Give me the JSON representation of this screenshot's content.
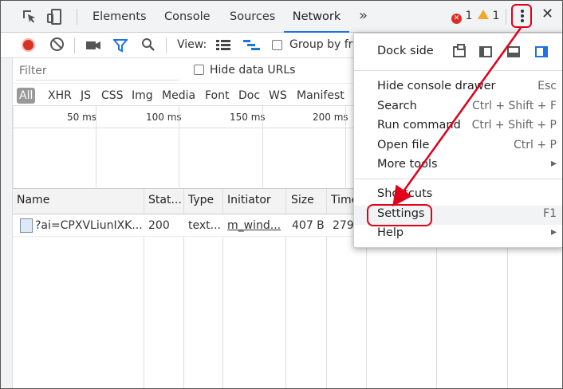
{
  "tabbar": {
    "tabs": [
      "Elements",
      "Console",
      "Sources",
      "Network"
    ],
    "active_tab": "Network",
    "more_label": "»",
    "error_count": "1",
    "warning_count": "1",
    "close_label": "✕"
  },
  "toolbar": {
    "view_label": "View:",
    "group_label": "Group by fra"
  },
  "filter": {
    "placeholder": "Filter",
    "hide_data_urls_label": "Hide data URLs"
  },
  "types": [
    "All",
    "XHR",
    "JS",
    "CSS",
    "Img",
    "Media",
    "Font",
    "Doc",
    "WS",
    "Manifest"
  ],
  "timeline": {
    "ticks": [
      "50 ms",
      "100 ms",
      "150 ms",
      "200 ms"
    ]
  },
  "table": {
    "columns": [
      "Name",
      "Stat...",
      "Type",
      "Initiator",
      "Size",
      "Time"
    ],
    "rows": [
      {
        "name": "?ai=CPXVLiunIXK...",
        "status": "200",
        "type": "text...",
        "initiator": "m_wind...",
        "size": "407 B",
        "time": "279"
      }
    ]
  },
  "menu": {
    "dock_side_label": "Dock side",
    "items": [
      {
        "label": "Hide console drawer",
        "shortcut": "Esc"
      },
      {
        "label": "Search",
        "shortcut": "Ctrl + Shift + F"
      },
      {
        "label": "Run command",
        "shortcut": "Ctrl + Shift + P"
      },
      {
        "label": "Open file",
        "shortcut": "Ctrl + P"
      },
      {
        "label": "More tools",
        "shortcut": "▸"
      }
    ],
    "items2": [
      {
        "label": "Shortcuts",
        "shortcut": ""
      },
      {
        "label": "Settings",
        "shortcut": "F1"
      },
      {
        "label": "Help",
        "shortcut": "▸"
      }
    ]
  },
  "colors": {
    "accent": "#1a73e8",
    "annotation": "#e0001a",
    "record": "#d93025",
    "warning": "#f2ab26"
  }
}
